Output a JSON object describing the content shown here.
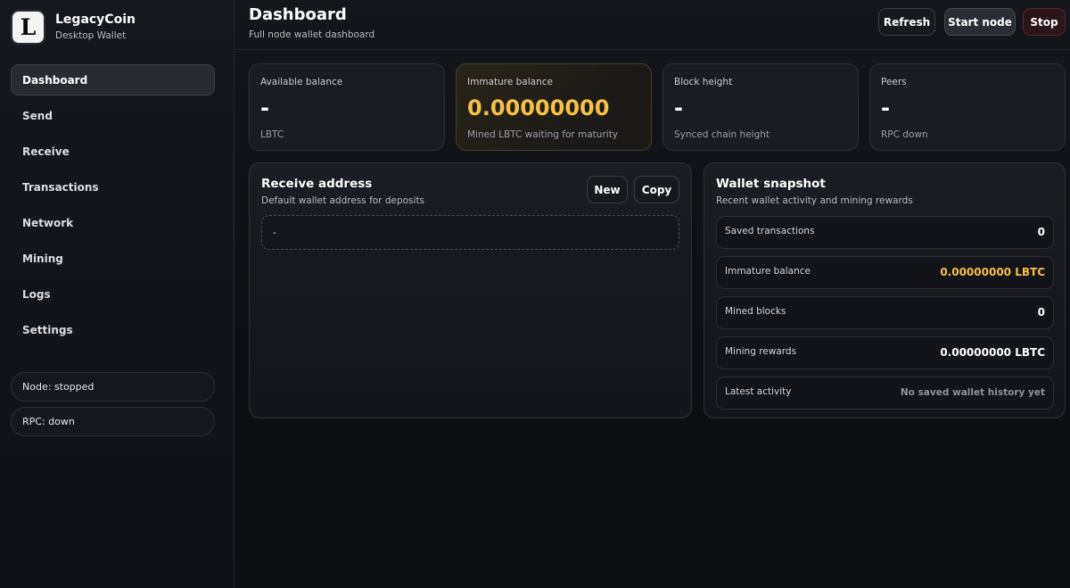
{
  "app": {
    "logo_letter": "L",
    "name": "LegacyCoin",
    "subtitle": "Desktop Wallet"
  },
  "sidebar": {
    "items": [
      {
        "label": "Dashboard",
        "active": true
      },
      {
        "label": "Send"
      },
      {
        "label": "Receive"
      },
      {
        "label": "Transactions"
      },
      {
        "label": "Network"
      },
      {
        "label": "Mining"
      },
      {
        "label": "Logs"
      },
      {
        "label": "Settings"
      }
    ],
    "node_status": "Node: stopped",
    "rpc_status": "RPC: down"
  },
  "header": {
    "title": "Dashboard",
    "subtitle": "Full node wallet dashboard",
    "refresh_label": "Refresh",
    "start_label": "Start node",
    "stop_label": "Stop"
  },
  "stats": [
    {
      "label": "Available balance",
      "value": "-",
      "foot": "LBTC"
    },
    {
      "label": "Immature balance",
      "value": "0.00000000",
      "foot": "Mined LBTC waiting for maturity"
    },
    {
      "label": "Block height",
      "value": "-",
      "foot": "Synced chain height"
    },
    {
      "label": "Peers",
      "value": "-",
      "foot": "RPC down"
    }
  ],
  "receive": {
    "title": "Receive address",
    "subtitle": "Default wallet address for deposits",
    "new_label": "New",
    "copy_label": "Copy",
    "address": "-"
  },
  "snapshot": {
    "title": "Wallet snapshot",
    "subtitle": "Recent wallet activity and mining rewards",
    "rows": [
      {
        "label": "Saved transactions",
        "value": "0"
      },
      {
        "label": "Immature balance",
        "value": "0.00000000 LBTC"
      },
      {
        "label": "Mined blocks",
        "value": "0"
      },
      {
        "label": "Mining rewards",
        "value": "0.00000000 LBTC"
      },
      {
        "label": "Latest activity",
        "value": "No saved wallet history yet"
      }
    ]
  },
  "colors": {
    "accent_gold": "#f6c046",
    "background": "#0d0f14",
    "stop_button": "#2a1518"
  }
}
